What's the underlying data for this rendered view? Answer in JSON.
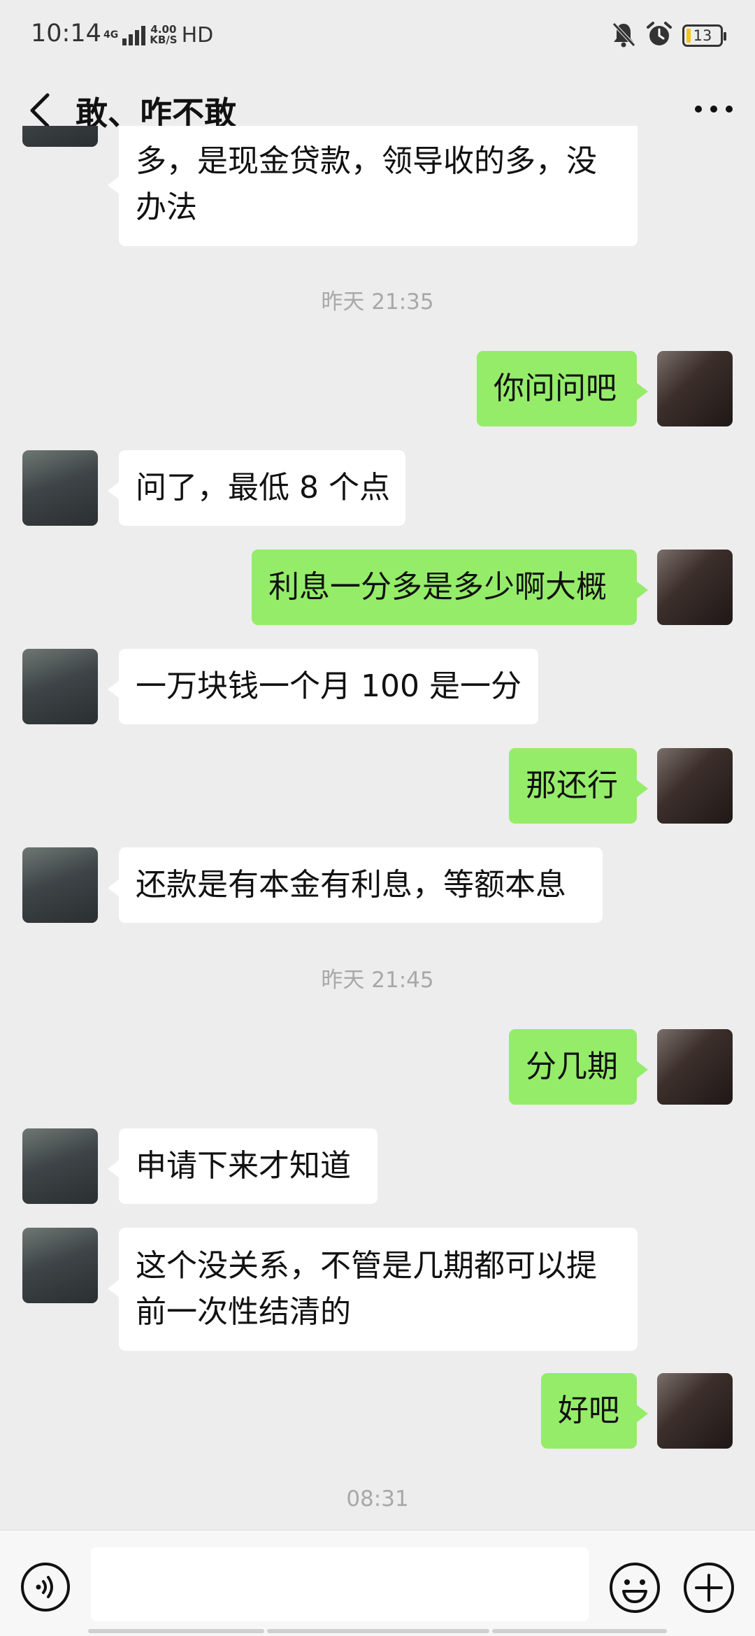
{
  "status_bar": {
    "time": "10:14",
    "network": "4G",
    "speed_value": "4.00",
    "speed_unit": "KB/S",
    "hd": "HD",
    "battery": "13"
  },
  "header": {
    "title": "敢、咋不敢"
  },
  "messages": {
    "m0": {
      "side": "left",
      "text": "多，是现金贷款，领导收的多，没办法"
    },
    "t1": "昨天 21:35",
    "m1": {
      "side": "right",
      "text": "你问问吧"
    },
    "m2": {
      "side": "left",
      "text": "问了，最低 8 个点"
    },
    "m3": {
      "side": "right",
      "text": "利息一分多是多少啊大概"
    },
    "m4": {
      "side": "left",
      "text": "一万块钱一个月 100 是一分"
    },
    "m5": {
      "side": "right",
      "text": "那还行"
    },
    "m6": {
      "side": "left",
      "text": "还款是有本金有利息，等额本息"
    },
    "t2": "昨天 21:45",
    "m7": {
      "side": "right",
      "text": "分几期"
    },
    "m8": {
      "side": "left",
      "text": "申请下来才知道"
    },
    "m9": {
      "side": "left",
      "text": "这个没关系，不管是几期都可以提前一次性结清的"
    },
    "m10": {
      "side": "right",
      "text": "好吧"
    },
    "t3": "08:31"
  },
  "input_bar": {
    "voice_icon": "voice-icon",
    "emoji_icon": "emoji-icon",
    "plus_icon": "plus-icon",
    "text_value": ""
  },
  "colors": {
    "background": "#ededed",
    "self_bubble": "#95ec69",
    "other_bubble": "#ffffff",
    "timestamp": "#a8a8a8"
  }
}
